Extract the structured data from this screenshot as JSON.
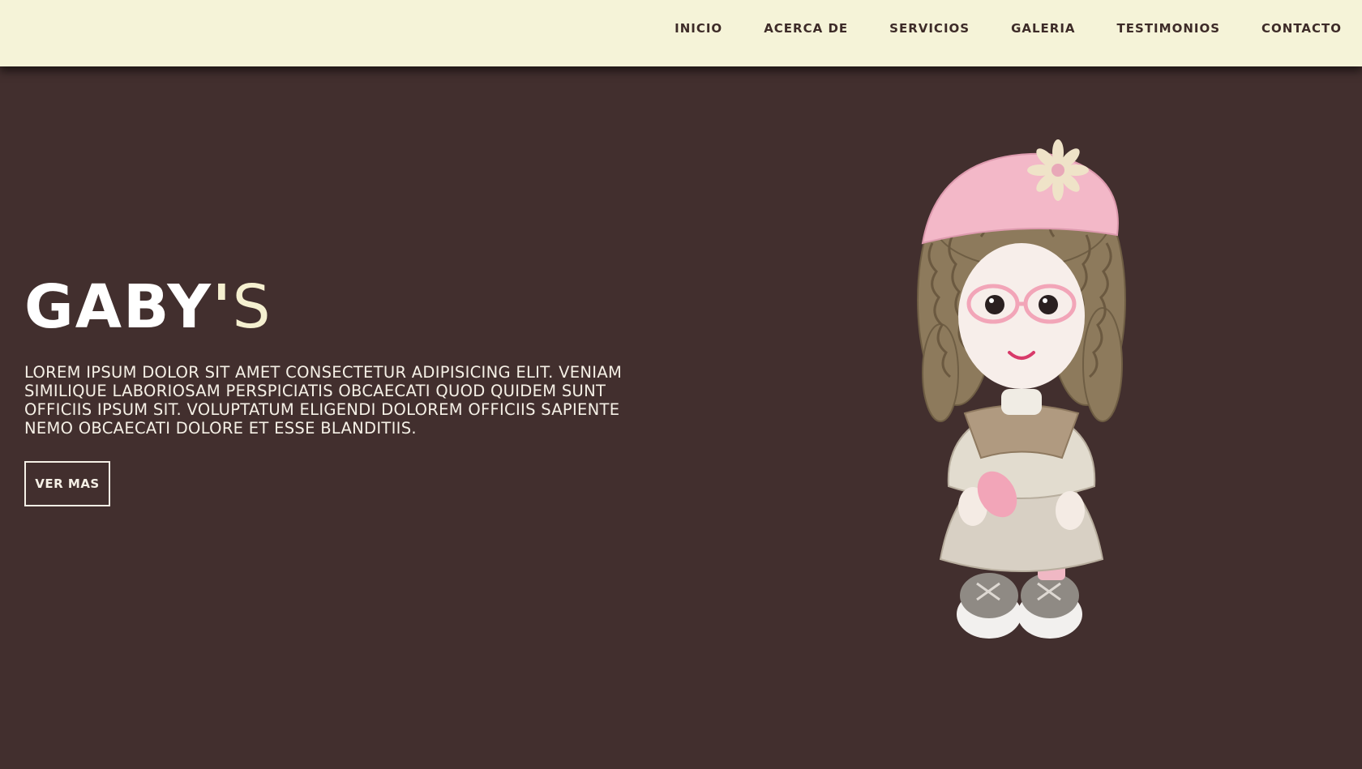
{
  "nav": {
    "items": [
      "INICIO",
      "ACERCA DE",
      "SERVICIOS",
      "GALERIA",
      "TESTIMONIOS",
      "CONTACTO"
    ]
  },
  "hero": {
    "brand_main": "GABY",
    "brand_apostrophe": "'",
    "brand_suffix": "S",
    "description": "LOREM IPSUM DOLOR SIT AMET CONSECTETUR ADIPISICING ELIT. VENIAM SIMILIQUE LABORIOSAM PERSPICIATIS OBCAECATI QUOD QUIDEM SUNT OFFICIIS IPSUM SIT. VOLUPTATUM ELIGENDI DOLOREM OFFICIIS SAPIENTE NEMO OBCAECATI DOLORE ET ESSE BLANDITIIS.",
    "cta_label": "VER MAS"
  },
  "colors": {
    "nav_bg": "#f5f3d8",
    "nav_text": "#3d2b28",
    "hero_bg": "#422f2e",
    "brand_accent": "#f5f0d0"
  },
  "image": {
    "subject": "clay-doll-figurine"
  }
}
